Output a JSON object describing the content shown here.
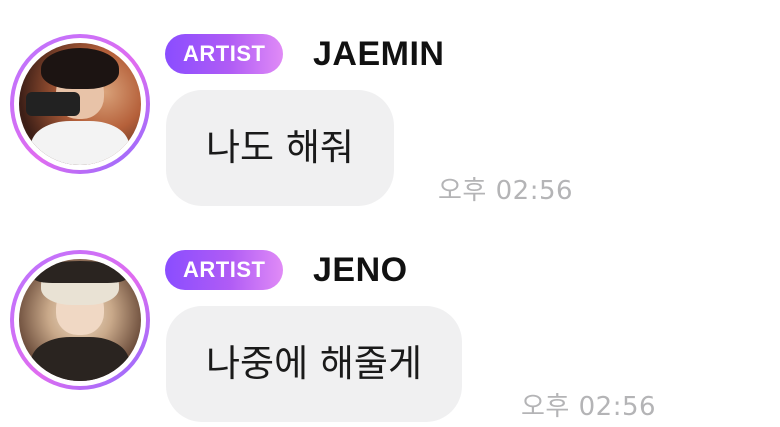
{
  "messages": [
    {
      "badge": "ARTIST",
      "name": "JAEMIN",
      "text": "나도 해줘",
      "time": "오후 02:56"
    },
    {
      "badge": "ARTIST",
      "name": "JENO",
      "text": "나중에 해줄게",
      "time": "오후 02:56"
    }
  ],
  "colors": {
    "badge_gradient_start": "#8a4dff",
    "badge_gradient_end": "#e08bf6",
    "bubble_background": "#f0f0f1",
    "timestamp_text": "#b4b4b6",
    "avatar_ring": "#c070f5"
  }
}
